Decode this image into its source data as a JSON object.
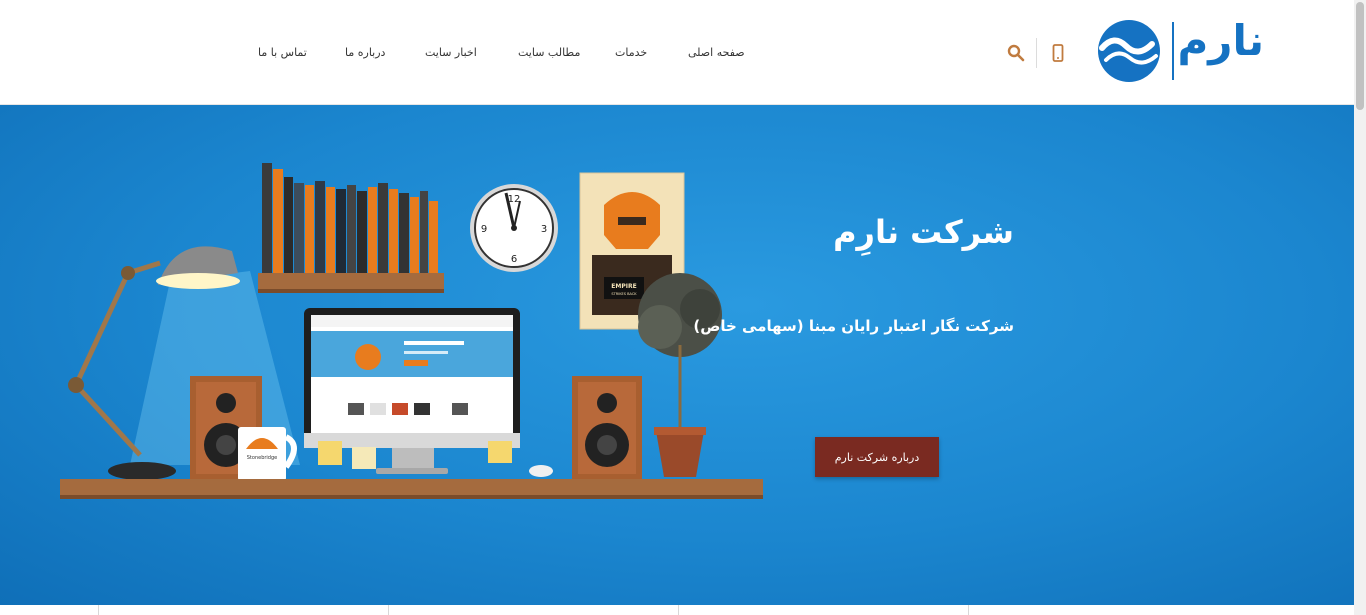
{
  "header": {
    "logo_text": "نارم",
    "nav": [
      {
        "label": "صفحه اصلی"
      },
      {
        "label": "خدمات"
      },
      {
        "label": "مطالب سایت"
      },
      {
        "label": "اخبار سایت"
      },
      {
        "label": "درباره ما"
      },
      {
        "label": "تماس با ما"
      }
    ],
    "icons": [
      "mobile-icon",
      "search-icon"
    ],
    "accent_color": "#c07b3f",
    "brand_color": "#1572c2"
  },
  "hero": {
    "title": "شرکت نارِم",
    "subtitle": "شرکت نگار اعتبار رایان مبنا (سهامی خاص)",
    "button_label": "درباره شرکت نارم",
    "button_color": "#7a2a21",
    "background_color": "#1b86cf"
  },
  "illustration": {
    "mug_text": "Stonebridge",
    "poster_text": "EMPIRE STRIKES BACK"
  }
}
